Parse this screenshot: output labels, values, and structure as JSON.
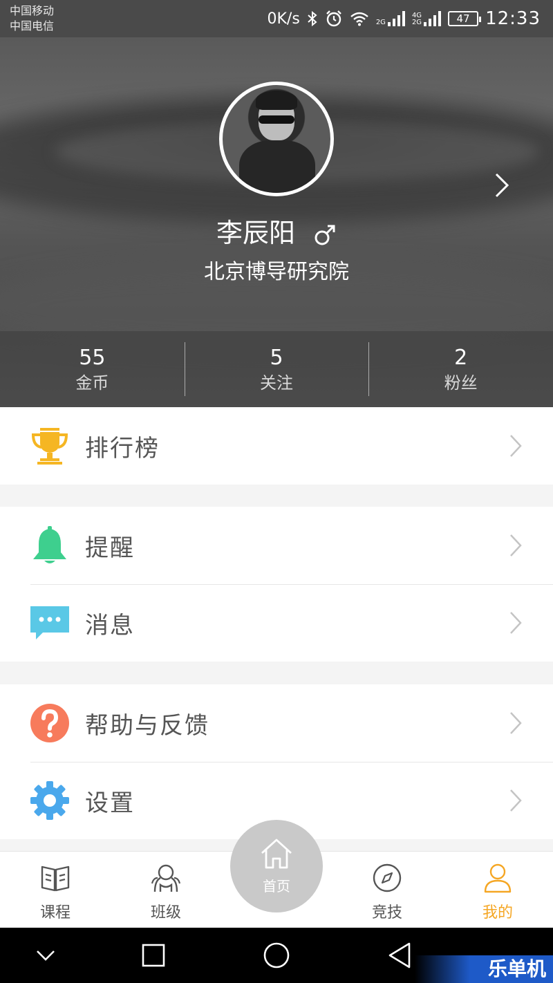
{
  "status_bar": {
    "carrier_1": "中国移动",
    "carrier_2": "中国电信",
    "speed": "0K/s",
    "battery": "47",
    "time": "12:33",
    "icons": [
      "bluetooth-icon",
      "alarm-icon",
      "wifi-icon",
      "signal-2g-icon",
      "signal-4g-2g-icon",
      "battery-icon"
    ]
  },
  "profile": {
    "name": "李辰阳",
    "gender_icon": "male-icon",
    "organization": "北京博导研究院",
    "stats": [
      {
        "value": "55",
        "label": "金币"
      },
      {
        "value": "5",
        "label": "关注"
      },
      {
        "value": "2",
        "label": "粉丝"
      }
    ]
  },
  "menu": {
    "ranking": {
      "label": "排行榜",
      "icon": "trophy-icon",
      "color": "#f5b623"
    },
    "reminder": {
      "label": "提醒",
      "icon": "bell-icon",
      "color": "#3ecf8e"
    },
    "message": {
      "label": "消息",
      "icon": "chat-icon",
      "color": "#5ac8e6"
    },
    "help": {
      "label": "帮助与反馈",
      "icon": "question-icon",
      "color": "#f77b5c"
    },
    "settings": {
      "label": "设置",
      "icon": "gear-icon",
      "color": "#4aa8ec"
    }
  },
  "bottom_nav": {
    "items": [
      {
        "label": "课程",
        "icon": "book-icon"
      },
      {
        "label": "班级",
        "icon": "class-icon"
      },
      {
        "label": "首页",
        "icon": "home-icon"
      },
      {
        "label": "竞技",
        "icon": "compass-icon"
      },
      {
        "label": "我的",
        "icon": "user-icon"
      }
    ],
    "active_color": "#f5a623"
  },
  "watermark": "乐单机"
}
